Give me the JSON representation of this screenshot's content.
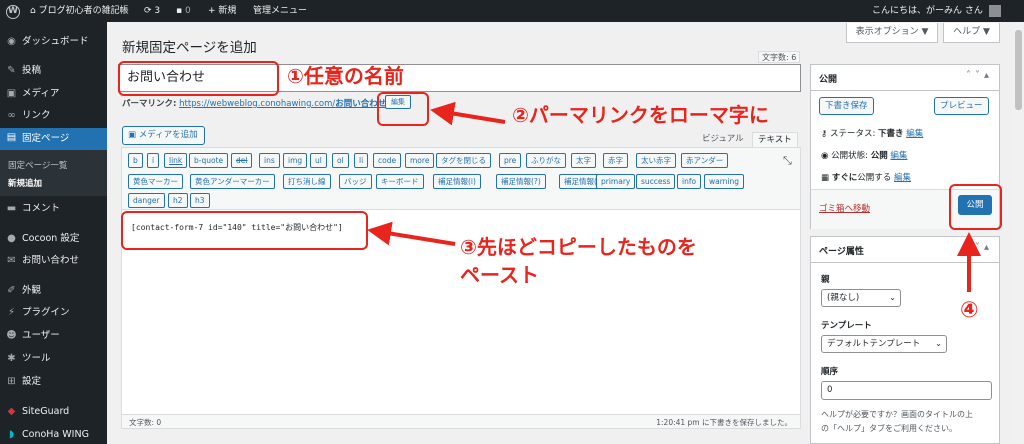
{
  "adminbar": {
    "site_name": "ブログ初心者の雑記帳",
    "updates_count": "3",
    "comments_count": "0",
    "new_label": "新規",
    "admin_menu_label": "管理メニュー",
    "greeting": "こんにちは、がーみん さん"
  },
  "sidebar": {
    "items": [
      {
        "label": "ダッシュボード",
        "icon": "dashboard-icon"
      },
      {
        "label": "投稿",
        "icon": "pin-icon"
      },
      {
        "label": "メディア",
        "icon": "media-icon"
      },
      {
        "label": "リンク",
        "icon": "link-icon"
      },
      {
        "label": "固定ページ",
        "icon": "page-icon"
      },
      {
        "label": "コメント",
        "icon": "comment-icon"
      },
      {
        "label": "Cocoon 設定",
        "icon": "cocoon-icon"
      },
      {
        "label": "お問い合わせ",
        "icon": "mail-icon"
      },
      {
        "label": "外観",
        "icon": "brush-icon"
      },
      {
        "label": "プラグイン",
        "icon": "plugin-icon"
      },
      {
        "label": "ユーザー",
        "icon": "user-icon"
      },
      {
        "label": "ツール",
        "icon": "wrench-icon"
      },
      {
        "label": "設定",
        "icon": "settings-icon"
      },
      {
        "label": "SiteGuard",
        "icon": "siteguard-icon"
      },
      {
        "label": "ConoHa WING",
        "icon": "conoha-icon"
      }
    ],
    "submenu": [
      "固定ページ一覧",
      "新規追加"
    ]
  },
  "main": {
    "page_title": "新規固定ページを追加",
    "screen_options": "表示オプション ▼",
    "help": "ヘルプ ▼",
    "word_count_top": "文字数: 6",
    "title_value": "お問い合わせ",
    "permalink_label": "パーマリンク:",
    "permalink_url": "https://webweblog.conohawing.com/",
    "permalink_slug": "お問い合わせ/",
    "permalink_edit": "編集",
    "add_media": "メディアを追加",
    "tab_visual": "ビジュアル",
    "tab_text": "テキスト",
    "toolbar_row1": [
      "b",
      "i",
      "link",
      "b-quote",
      "del",
      "ins",
      "img",
      "ul",
      "ol",
      "li",
      "code",
      "more",
      "タグを閉じる",
      "pre",
      "ふりがな",
      "太字",
      "赤字",
      "太い赤字",
      "赤アンダー"
    ],
    "toolbar_row2": [
      "黄色マーカー",
      "黄色アンダーマーカー",
      "打ち消し線",
      "バッジ",
      "キーボード",
      "補足情報(i)",
      "補足情報(?)",
      "補足情報(!)",
      "primary",
      "success",
      "info",
      "warning"
    ],
    "toolbar_row3": [
      "danger",
      "h2",
      "h3"
    ],
    "editor_content": "[contact-form-7 id=\"140\" title=\"お問い合わせ\"]",
    "status_word_count": "文字数: 0",
    "status_saved": "1:20:41 pm に下書きを保存しました。"
  },
  "publish_box": {
    "title": "公開",
    "save_draft": "下書き保存",
    "preview": "プレビュー",
    "status_label": "ステータス:",
    "status_value": "下書き",
    "visibility_label": "公開状態:",
    "visibility_value": "公開",
    "schedule_label": "すぐに",
    "schedule_suffix": "公開する",
    "edit_link": "編集",
    "trash": "ゴミ箱へ移動",
    "publish": "公開"
  },
  "attributes_box": {
    "title": "ページ属性",
    "parent_label": "親",
    "parent_value": "(親なし)",
    "template_label": "テンプレート",
    "template_value": "デフォルトテンプレート",
    "order_label": "順序",
    "order_value": "0",
    "help_text_1": "ヘルプが必要ですか？画面のタイトルの上",
    "help_text_2": "の「ヘルプ」タブをご利用ください。"
  },
  "annotations": {
    "step1": "①任意の名前",
    "step2": "②パーマリンクをローマ字に",
    "step3_line1": "③先ほどコピーしたものを",
    "step3_line2": "ペースト",
    "step4": "④",
    "color": "#e8241c"
  }
}
